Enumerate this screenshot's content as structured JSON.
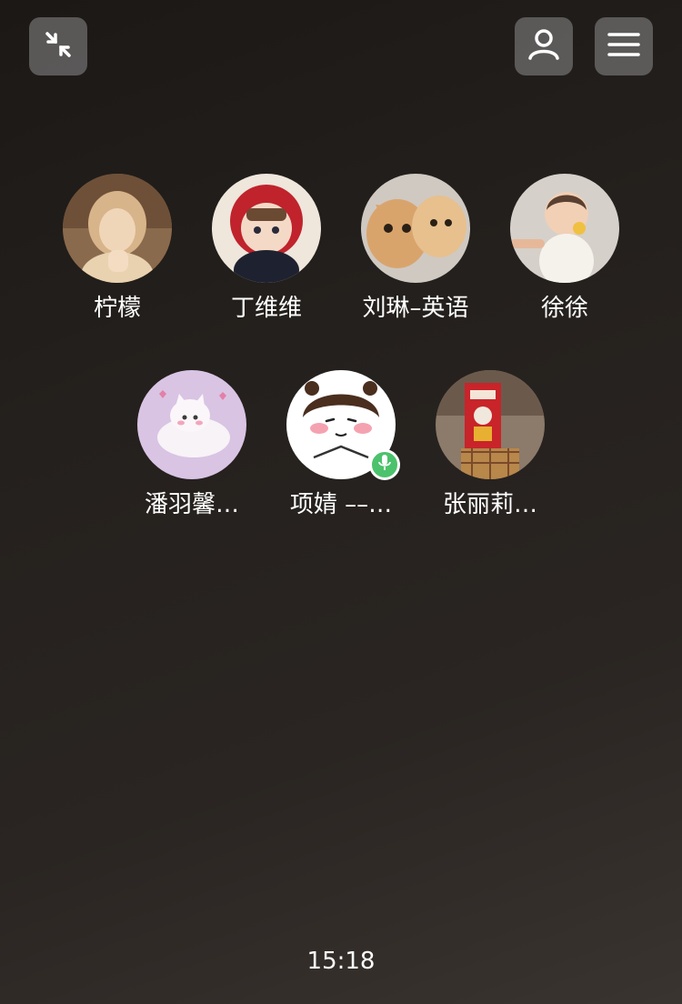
{
  "controls": {
    "minimize_icon": "minimize-arrows-icon",
    "contacts_icon": "person-icon",
    "menu_icon": "hamburger-menu-icon"
  },
  "participants": [
    {
      "name": "柠檬",
      "speaking": false
    },
    {
      "name": "丁维维",
      "speaking": false
    },
    {
      "name": "刘琳–英语",
      "speaking": false
    },
    {
      "name": "徐徐",
      "speaking": false
    },
    {
      "name": "潘羽馨…",
      "speaking": false
    },
    {
      "name": "项婧 ––…",
      "speaking": true
    },
    {
      "name": "张丽莉…",
      "speaking": false
    }
  ],
  "status": {
    "time": "15:18"
  },
  "colors": {
    "mic_active": "#4cc26c",
    "button_bg": "#808080"
  }
}
